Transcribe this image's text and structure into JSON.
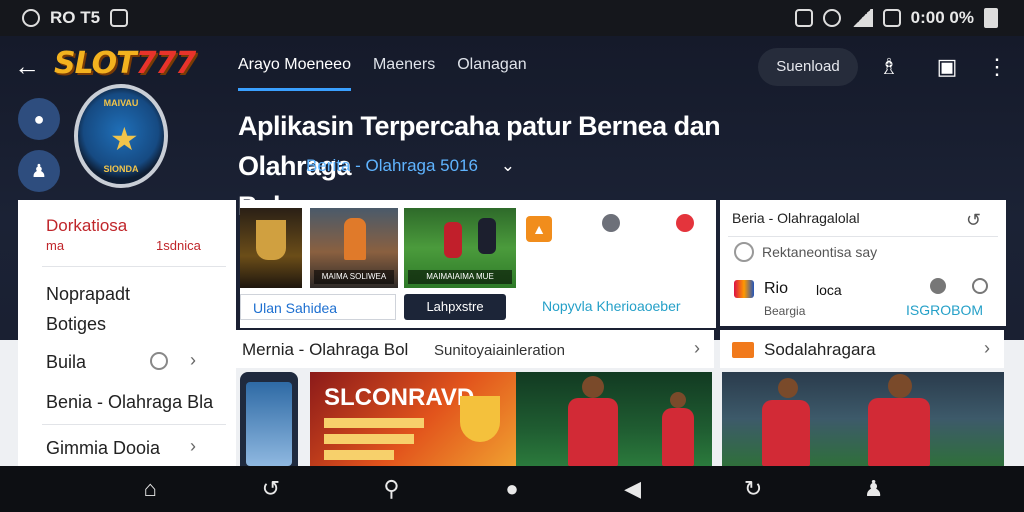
{
  "status_bar": {
    "left_text": "RO T5",
    "right_text": "0:00 0%"
  },
  "header": {
    "logo_main": "SLOT",
    "logo_num": "777",
    "tabs": [
      {
        "label": "Arayo Moeneeo",
        "active": true
      },
      {
        "label": "Maeners",
        "active": false
      },
      {
        "label": "Olanagan",
        "active": false
      }
    ],
    "signin_label": "Suenload",
    "badge_top": "MAIVAU",
    "badge_bottom": "SIONDA",
    "headline_line1": "Aplikasin Terpercaha patur Bernea dan Olahraga",
    "headline_line2": "Bola",
    "sub_link": "Berita - Olahraga 5016",
    "accent_color": "#3aa0ff"
  },
  "left_panel": {
    "title": "Dorkatiosa",
    "sub_left": "ma",
    "sub_right": "1sdnica",
    "items": [
      {
        "label": "Noprapadt"
      },
      {
        "label": "Botiges"
      },
      {
        "label": "Buila"
      },
      {
        "label": "Benia - Olahraga Bla"
      },
      {
        "label": "Gimmia Dooia"
      }
    ]
  },
  "cards": {
    "thumb2_caption": "MAIMA SOLIWEA",
    "thumb3_caption": "MAIMAIAIMA MUE",
    "button_a": "Ulan Sahidea",
    "button_b": "Lahpxstre",
    "button_c": "Nopyvla Kherioaoeber"
  },
  "right_panel": {
    "title": "Beria - Olahragalolal",
    "row1": "Rektaneontisa say",
    "row2_title": "Rio",
    "row2_value": "loca",
    "row3_label": "Beargia",
    "row3_value": "ISGROBOM"
  },
  "sections": {
    "left_title": "Mernia - Olahraga Bol",
    "left_sub": "Sunitoyaiainleration",
    "right_title": "Sodalahragara"
  },
  "banners": {
    "promo_title": "SLCONRAVD"
  }
}
